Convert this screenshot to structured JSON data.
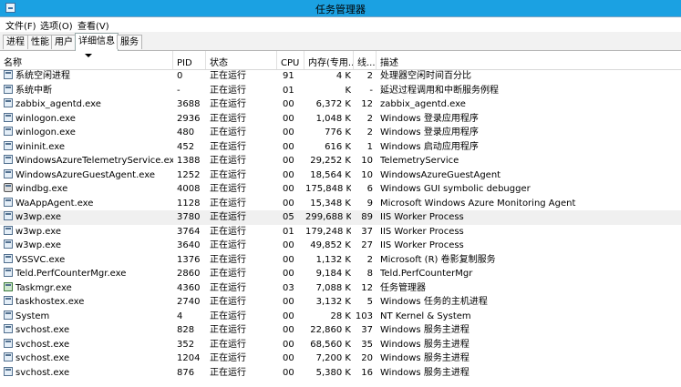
{
  "window": {
    "title": "任务管理器"
  },
  "menu": [
    "文件(F)",
    "选项(O)",
    "查看(V)"
  ],
  "tabs": [
    "进程",
    "性能",
    "用户",
    "详细信息",
    "服务"
  ],
  "active_tab": 3,
  "columns": {
    "name": "名称",
    "pid": "PID",
    "status": "状态",
    "cpu": "CPU",
    "memory": "内存(专用...",
    "handles": "线...",
    "description": "描述"
  },
  "rows": [
    {
      "name": "系统空闲进程",
      "pid": "0",
      "status": "正在运行",
      "cpu": "91",
      "memory": "4 K",
      "handles": "2",
      "description": "处理器空闲时间百分比",
      "icon": "process-icon"
    },
    {
      "name": "系统中断",
      "pid": "-",
      "status": "正在运行",
      "cpu": "01",
      "memory": "K",
      "handles": "-",
      "description": "延迟过程调用和中断服务例程",
      "icon": "process-icon"
    },
    {
      "name": "zabbix_agentd.exe",
      "pid": "3688",
      "status": "正在运行",
      "cpu": "00",
      "memory": "6,372 K",
      "handles": "12",
      "description": "zabbix_agentd.exe",
      "icon": "process-icon"
    },
    {
      "name": "winlogon.exe",
      "pid": "2936",
      "status": "正在运行",
      "cpu": "00",
      "memory": "1,048 K",
      "handles": "2",
      "description": "Windows 登录应用程序",
      "icon": "process-icon"
    },
    {
      "name": "winlogon.exe",
      "pid": "480",
      "status": "正在运行",
      "cpu": "00",
      "memory": "776 K",
      "handles": "2",
      "description": "Windows 登录应用程序",
      "icon": "process-icon"
    },
    {
      "name": "wininit.exe",
      "pid": "452",
      "status": "正在运行",
      "cpu": "00",
      "memory": "616 K",
      "handles": "1",
      "description": "Windows 启动应用程序",
      "icon": "process-icon"
    },
    {
      "name": "WindowsAzureTelemetryService.exe",
      "pid": "1388",
      "status": "正在运行",
      "cpu": "00",
      "memory": "29,252 K",
      "handles": "10",
      "description": "TelemetryService",
      "icon": "process-icon"
    },
    {
      "name": "WindowsAzureGuestAgent.exe",
      "pid": "1252",
      "status": "正在运行",
      "cpu": "00",
      "memory": "18,564 K",
      "handles": "10",
      "description": "WindowsAzureGuestAgent",
      "icon": "process-icon"
    },
    {
      "name": "windbg.exe",
      "pid": "4008",
      "status": "正在运行",
      "cpu": "00",
      "memory": "175,848 K",
      "handles": "6",
      "description": "Windows GUI symbolic debugger",
      "icon": "windbg-icon"
    },
    {
      "name": "WaAppAgent.exe",
      "pid": "1128",
      "status": "正在运行",
      "cpu": "00",
      "memory": "15,348 K",
      "handles": "9",
      "description": "Microsoft Windows Azure Monitoring Agent",
      "icon": "process-icon"
    },
    {
      "name": "w3wp.exe",
      "pid": "3780",
      "status": "正在运行",
      "cpu": "05",
      "memory": "299,688 K",
      "handles": "89",
      "description": "IIS Worker Process",
      "icon": "process-icon",
      "selected": true
    },
    {
      "name": "w3wp.exe",
      "pid": "3764",
      "status": "正在运行",
      "cpu": "01",
      "memory": "179,248 K",
      "handles": "37",
      "description": "IIS Worker Process",
      "icon": "process-icon"
    },
    {
      "name": "w3wp.exe",
      "pid": "3640",
      "status": "正在运行",
      "cpu": "00",
      "memory": "49,852 K",
      "handles": "27",
      "description": "IIS Worker Process",
      "icon": "process-icon"
    },
    {
      "name": "VSSVC.exe",
      "pid": "1376",
      "status": "正在运行",
      "cpu": "00",
      "memory": "1,132 K",
      "handles": "2",
      "description": "Microsoft (R) 卷影复制服务",
      "icon": "process-icon"
    },
    {
      "name": "Teld.PerfCounterMgr.exe",
      "pid": "2860",
      "status": "正在运行",
      "cpu": "00",
      "memory": "9,184 K",
      "handles": "8",
      "description": "Teld.PerfCounterMgr",
      "icon": "process-icon"
    },
    {
      "name": "Taskmgr.exe",
      "pid": "4360",
      "status": "正在运行",
      "cpu": "03",
      "memory": "7,088 K",
      "handles": "12",
      "description": "任务管理器",
      "icon": "taskmgr-icon"
    },
    {
      "name": "taskhostex.exe",
      "pid": "2740",
      "status": "正在运行",
      "cpu": "00",
      "memory": "3,132 K",
      "handles": "5",
      "description": "Windows 任务的主机进程",
      "icon": "process-icon"
    },
    {
      "name": "System",
      "pid": "4",
      "status": "正在运行",
      "cpu": "00",
      "memory": "28 K",
      "handles": "103",
      "description": "NT Kernel & System",
      "icon": "process-icon"
    },
    {
      "name": "svchost.exe",
      "pid": "828",
      "status": "正在运行",
      "cpu": "00",
      "memory": "22,860 K",
      "handles": "37",
      "description": "Windows 服务主进程",
      "icon": "process-icon"
    },
    {
      "name": "svchost.exe",
      "pid": "352",
      "status": "正在运行",
      "cpu": "00",
      "memory": "68,560 K",
      "handles": "35",
      "description": "Windows 服务主进程",
      "icon": "process-icon"
    },
    {
      "name": "svchost.exe",
      "pid": "1204",
      "status": "正在运行",
      "cpu": "00",
      "memory": "7,200 K",
      "handles": "20",
      "description": "Windows 服务主进程",
      "icon": "process-icon"
    },
    {
      "name": "svchost.exe",
      "pid": "876",
      "status": "正在运行",
      "cpu": "00",
      "memory": "5,380 K",
      "handles": "16",
      "description": "Windows 服务主进程",
      "icon": "process-icon"
    }
  ]
}
